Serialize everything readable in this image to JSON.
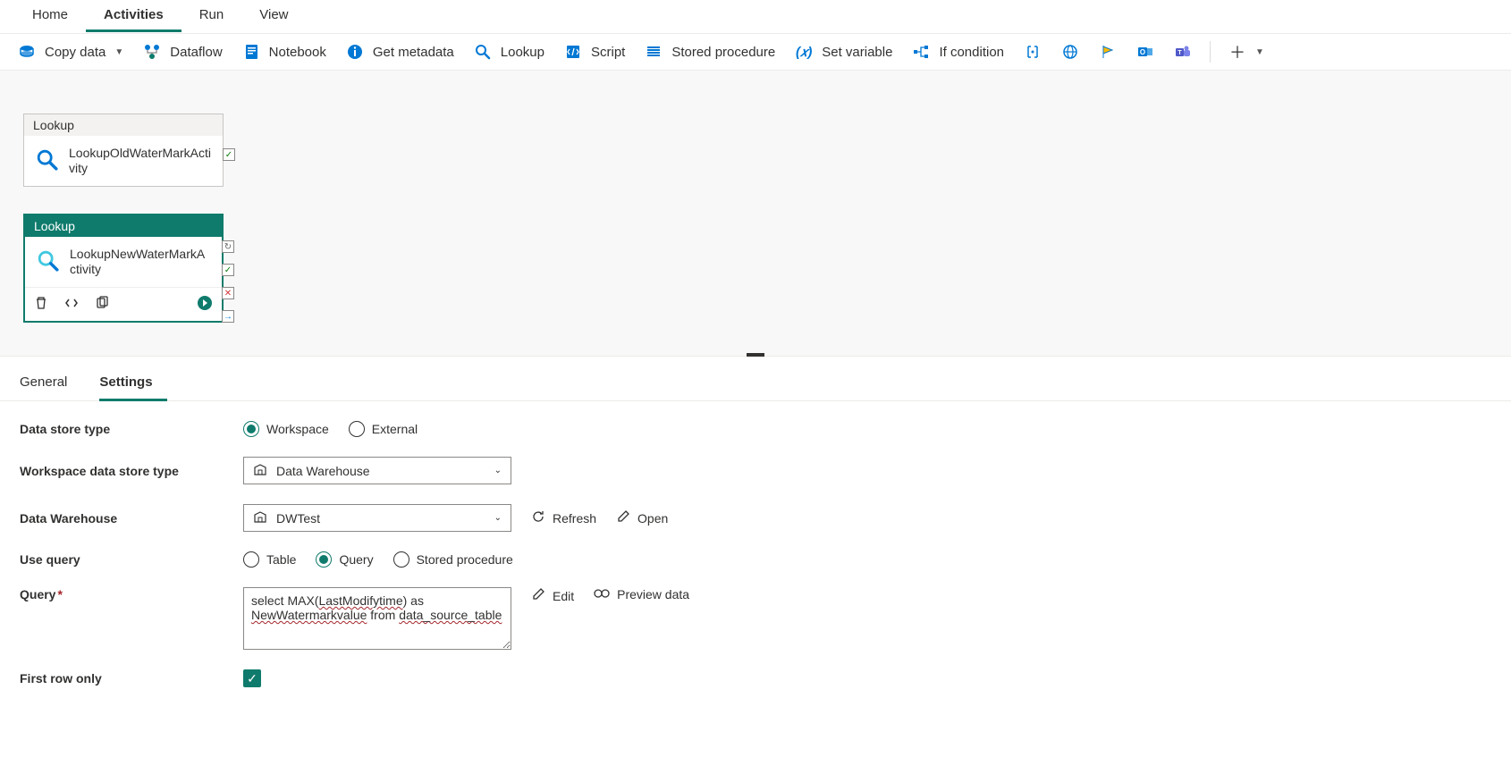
{
  "nav": {
    "tabs": [
      "Home",
      "Activities",
      "Run",
      "View"
    ],
    "active": 1
  },
  "toolbar": {
    "copy_data": "Copy data",
    "dataflow": "Dataflow",
    "notebook": "Notebook",
    "get_metadata": "Get metadata",
    "lookup": "Lookup",
    "script": "Script",
    "stored_procedure": "Stored procedure",
    "set_variable": "Set variable",
    "if_condition": "If condition"
  },
  "nodes": {
    "n1": {
      "type": "Lookup",
      "name": "LookupOldWaterMarkActivity"
    },
    "n2": {
      "type": "Lookup",
      "name": "LookupNewWaterMarkActivity"
    }
  },
  "bottom_tabs": {
    "tabs": [
      "General",
      "Settings"
    ],
    "active": 1
  },
  "form": {
    "labels": {
      "data_store_type": "Data store type",
      "workspace_type": "Workspace data store type",
      "data_warehouse": "Data Warehouse",
      "use_query": "Use query",
      "query": "Query",
      "first_row": "First row only"
    },
    "data_store_type": {
      "opt1": "Workspace",
      "opt2": "External",
      "selected": "Workspace"
    },
    "workspace_type_value": "Data Warehouse",
    "data_warehouse_value": "DWTest",
    "refresh": "Refresh",
    "open": "Open",
    "use_query": {
      "opt1": "Table",
      "opt2": "Query",
      "opt3": "Stored procedure",
      "selected": "Query"
    },
    "query_value": "select MAX(LastModifytime) as NewWatermarkvalue from data_source_table",
    "edit": "Edit",
    "preview": "Preview data",
    "first_row_checked": true
  }
}
